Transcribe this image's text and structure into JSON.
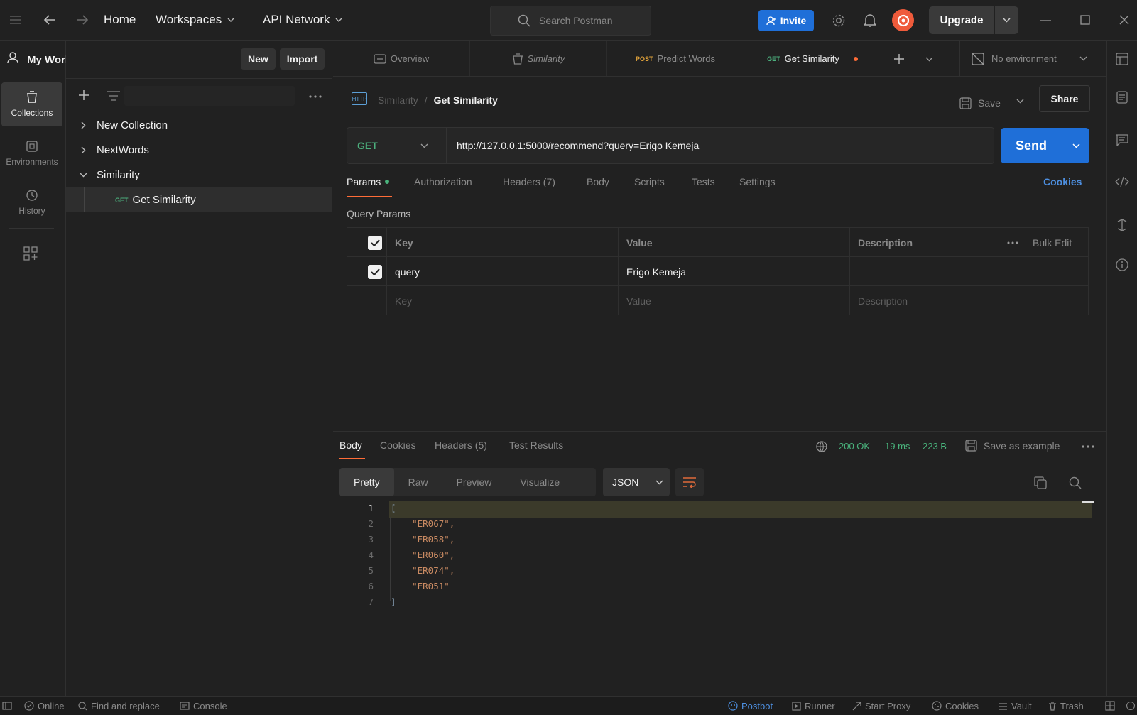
{
  "titlebar": {
    "home": "Home",
    "workspaces": "Workspaces",
    "api_network": "API Network",
    "search_placeholder": "Search Postman",
    "invite": "Invite",
    "upgrade": "Upgrade"
  },
  "workspace": {
    "name": "My Workspace",
    "new_label": "New",
    "import_label": "Import"
  },
  "rail": [
    {
      "label": "Collections",
      "icon": "collections-icon"
    },
    {
      "label": "Environments",
      "icon": "environments-icon"
    },
    {
      "label": "History",
      "icon": "history-icon"
    }
  ],
  "tree": {
    "collections": [
      "New Collection",
      "NextWords",
      "Similarity"
    ],
    "request": {
      "method": "GET",
      "name": "Get Similarity"
    }
  },
  "tabs": [
    {
      "label": "Overview",
      "method": ""
    },
    {
      "label": "Similarity",
      "method": ""
    },
    {
      "label": "Predict Words",
      "method": "POST"
    },
    {
      "label": "Get Similarity",
      "method": "GET"
    }
  ],
  "environment": "No environment",
  "request": {
    "breadcrumb_parent": "Similarity",
    "breadcrumb_sep": "/",
    "title": "Get Similarity",
    "http_badge": "HTTP",
    "save": "Save",
    "share": "Share",
    "method": "GET",
    "url": "http://127.0.0.1:5000/recommend?query=Erigo Kemeja",
    "send": "Send",
    "tabs": [
      "Params",
      "Authorization",
      "Headers (7)",
      "Body",
      "Scripts",
      "Tests",
      "Settings"
    ],
    "cookies": "Cookies",
    "query_params_title": "Query Params",
    "table": {
      "headers": {
        "key": "Key",
        "value": "Value",
        "description": "Description",
        "bulk_edit": "Bulk Edit"
      },
      "rows": [
        {
          "key": "query",
          "value": "Erigo Kemeja",
          "description": ""
        }
      ],
      "placeholders": {
        "key": "Key",
        "value": "Value",
        "description": "Description"
      }
    }
  },
  "response": {
    "tabs": [
      "Body",
      "Cookies",
      "Headers (5)",
      "Test Results"
    ],
    "status": "200 OK",
    "time": "19 ms",
    "size": "223 B",
    "save_example": "Save as example",
    "views": [
      "Pretty",
      "Raw",
      "Preview",
      "Visualize"
    ],
    "format": "JSON",
    "code_lines": [
      {
        "n": "1",
        "text": "["
      },
      {
        "n": "2",
        "text": "    \"ER067\","
      },
      {
        "n": "3",
        "text": "    \"ER058\","
      },
      {
        "n": "4",
        "text": "    \"ER060\","
      },
      {
        "n": "5",
        "text": "    \"ER074\","
      },
      {
        "n": "6",
        "text": "    \"ER051\""
      },
      {
        "n": "7",
        "text": "]"
      }
    ]
  },
  "statusbar": {
    "online": "Online",
    "find_replace": "Find and replace",
    "console": "Console",
    "postbot": "Postbot",
    "runner": "Runner",
    "start_proxy": "Start Proxy",
    "cookies": "Cookies",
    "vault": "Vault",
    "trash": "Trash"
  },
  "colors": {
    "accent_blue": "#1f6fd8",
    "active_tab_underline": "#ff6c37",
    "status_green": "#49b37c",
    "method_get": "#4caf7d",
    "method_post": "#e0a23a",
    "code_string": "#c98a62"
  }
}
